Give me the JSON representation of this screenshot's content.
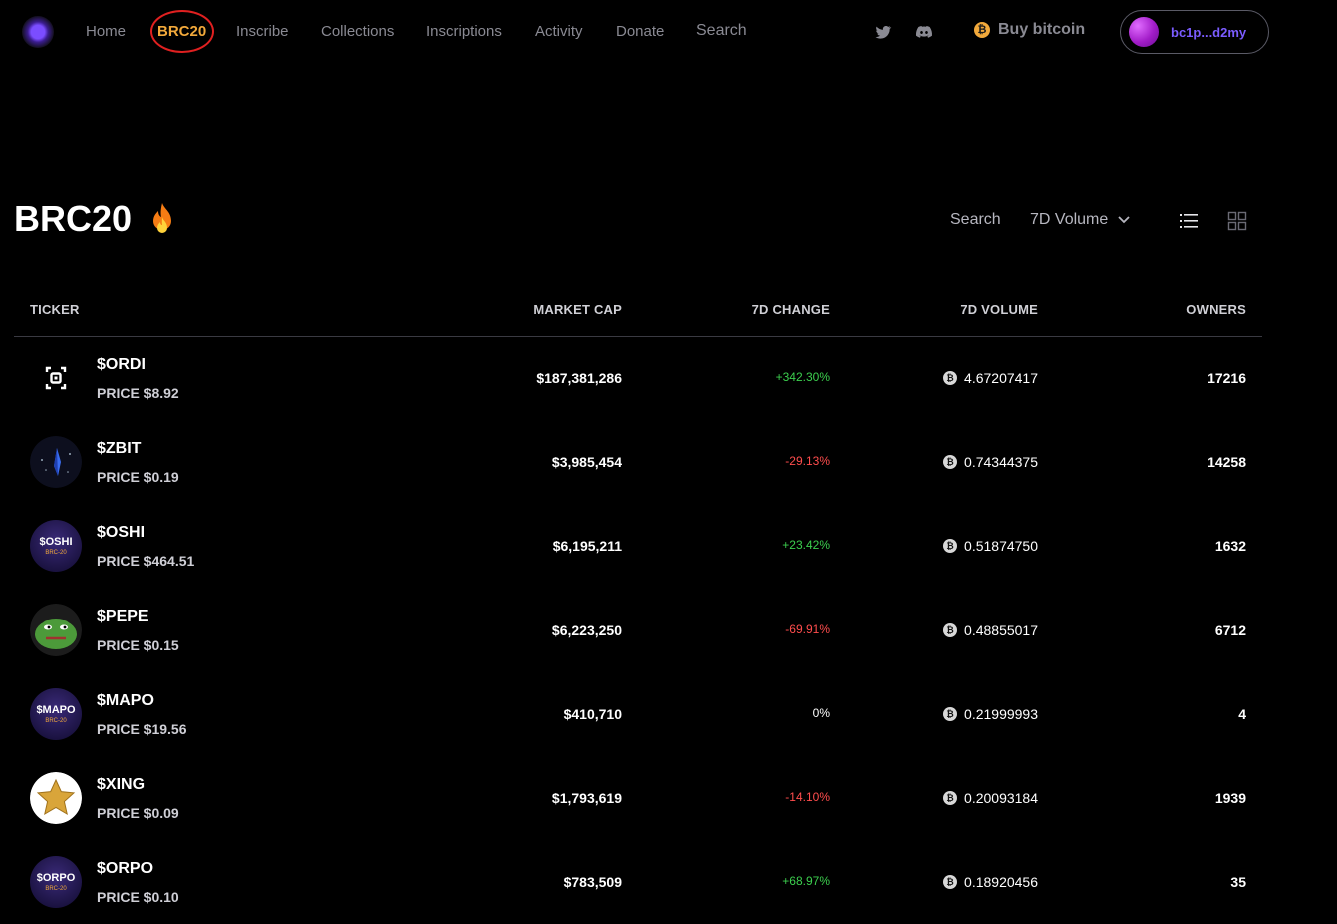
{
  "nav": {
    "links": [
      "Home",
      "BRC20",
      "Inscribe",
      "Collections",
      "Inscriptions",
      "Activity",
      "Donate"
    ],
    "active": "BRC20",
    "search_label": "Search",
    "buy_label": "Buy bitcoin",
    "wallet_address": "bc1p...d2my"
  },
  "header": {
    "title": "BRC20",
    "search_label": "Search",
    "sort_label": "7D Volume"
  },
  "table": {
    "columns": [
      "TICKER",
      "MARKET CAP",
      "7D CHANGE",
      "7D VOLUME",
      "OWNERS"
    ],
    "rows": [
      {
        "ticker": "$ORDI",
        "price": "PRICE $8.92",
        "market_cap": "$187,381,286",
        "change": "+342.30%",
        "trend": "positive",
        "volume": "4.67207417",
        "owners": "17216",
        "icon": "ordi-logo-icon"
      },
      {
        "ticker": "$ZBIT",
        "price": "PRICE $0.19",
        "market_cap": "$3,985,454",
        "change": "-29.13%",
        "trend": "negative",
        "volume": "0.74344375",
        "owners": "14258",
        "icon": "zbit-logo-icon"
      },
      {
        "ticker": "$OSHI",
        "price": "PRICE $464.51",
        "market_cap": "$6,195,211",
        "change": "+23.42%",
        "trend": "positive",
        "volume": "0.51874750",
        "owners": "1632",
        "icon": "oshi-logo-icon",
        "badge": "$OSHI",
        "badge_sub": "BRC-20"
      },
      {
        "ticker": "$PEPE",
        "price": "PRICE $0.15",
        "market_cap": "$6,223,250",
        "change": "-69.91%",
        "trend": "negative",
        "volume": "0.48855017",
        "owners": "6712",
        "icon": "pepe-logo-icon"
      },
      {
        "ticker": "$MAPO",
        "price": "PRICE $19.56",
        "market_cap": "$410,710",
        "change": "0%",
        "trend": "neutral",
        "volume": "0.21999993",
        "owners": "4",
        "icon": "mapo-logo-icon",
        "badge": "$MAPO",
        "badge_sub": "BRC-20"
      },
      {
        "ticker": "$XING",
        "price": "PRICE $0.09",
        "market_cap": "$1,793,619",
        "change": "-14.10%",
        "trend": "negative",
        "volume": "0.20093184",
        "owners": "1939",
        "icon": "star-logo-icon"
      },
      {
        "ticker": "$ORPO",
        "price": "PRICE $0.10",
        "market_cap": "$783,509",
        "change": "+68.97%",
        "trend": "positive",
        "volume": "0.18920456",
        "owners": "35",
        "icon": "orpo-logo-icon",
        "badge": "$ORPO",
        "badge_sub": "BRC-20"
      }
    ]
  },
  "colors": {
    "background": "#000000",
    "active_nav": "#f2a93b",
    "positive": "#3ccf4e",
    "negative": "#ff4d4d",
    "wallet_text": "#7b5cff"
  }
}
